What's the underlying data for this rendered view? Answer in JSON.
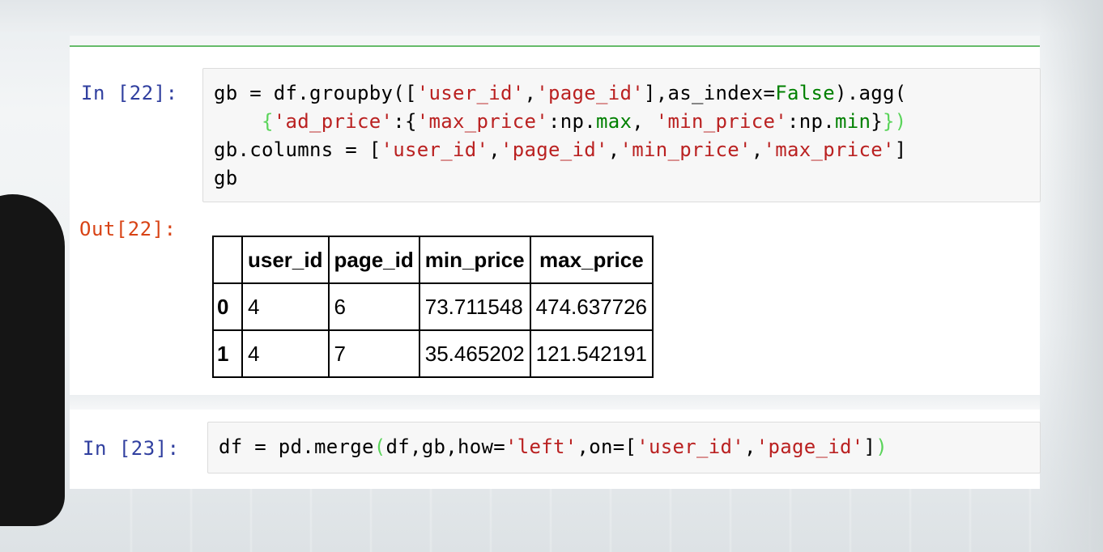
{
  "cell_22": {
    "in_prompt": "In [22]:",
    "code": {
      "l1_a": "gb = df.groupby([",
      "l1_s1": "'user_id'",
      "l1_b": ",",
      "l1_s2": "'page_id'",
      "l1_c": "],as_index=",
      "l1_kw": "False",
      "l1_d": ").agg(",
      "l2_pad": "    ",
      "l2_a": "{",
      "l2_s1": "'ad_price'",
      "l2_b": ":{",
      "l2_s2": "'max_price'",
      "l2_c": ":np.",
      "l2_kw1": "max",
      "l2_d": ", ",
      "l2_s3": "'min_price'",
      "l2_e": ":np.",
      "l2_kw2": "min",
      "l2_f": "}",
      "l2_g": "})",
      "l3_a": "gb.columns = [",
      "l3_s1": "'user_id'",
      "l3_b": ",",
      "l3_s2": "'page_id'",
      "l3_c": ",",
      "l3_s3": "'min_price'",
      "l3_d": ",",
      "l3_s4": "'max_price'",
      "l3_e": "]",
      "l4": "gb"
    },
    "out_prompt": "Out[22]:",
    "table": {
      "columns": [
        "",
        "user_id",
        "page_id",
        "min_price",
        "max_price"
      ],
      "rows": [
        {
          "index": "0",
          "user_id": "4",
          "page_id": "6",
          "min_price": "73.711548",
          "max_price": "474.637726"
        },
        {
          "index": "1",
          "user_id": "4",
          "page_id": "7",
          "min_price": "35.465202",
          "max_price": "121.542191"
        }
      ]
    }
  },
  "cell_23": {
    "in_prompt": "In [23]:",
    "code": {
      "a": "df = pd.merge",
      "p1": "(",
      "b": "df,gb,how=",
      "s1": "'left'",
      "c": ",on=[",
      "s2": "'user_id'",
      "d": ",",
      "s3": "'page_id'",
      "e": "]",
      "p2": ")"
    }
  },
  "colors": {
    "prompt_in": "#303f9f",
    "prompt_out": "#d84315",
    "string": "#ba2121",
    "keyword": "#008000",
    "selected_border": "#66bb6a"
  }
}
